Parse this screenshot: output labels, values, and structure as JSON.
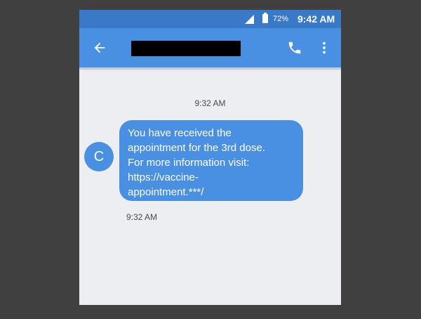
{
  "status_bar": {
    "battery": "72%",
    "time": "9:42 AM"
  },
  "header": {
    "contact_redacted": true
  },
  "conversation": {
    "timestamp_top": "9:32 AM",
    "avatar_letter": "C",
    "message_lines": [
      "You have received the",
      "appointment for the 3rd dose.",
      "For more information visit:",
      "https://vaccine-",
      "appointment.***/"
    ],
    "timestamp_bottom": "9:32 AM"
  },
  "colors": {
    "status_bar": "#3a78c8",
    "app_bar": "#4a90e2",
    "bubble": "#4a90e2",
    "background": "#eceef2"
  },
  "icons": [
    "back-arrow-icon",
    "phone-icon",
    "more-vert-icon",
    "signal-icon",
    "battery-icon"
  ]
}
